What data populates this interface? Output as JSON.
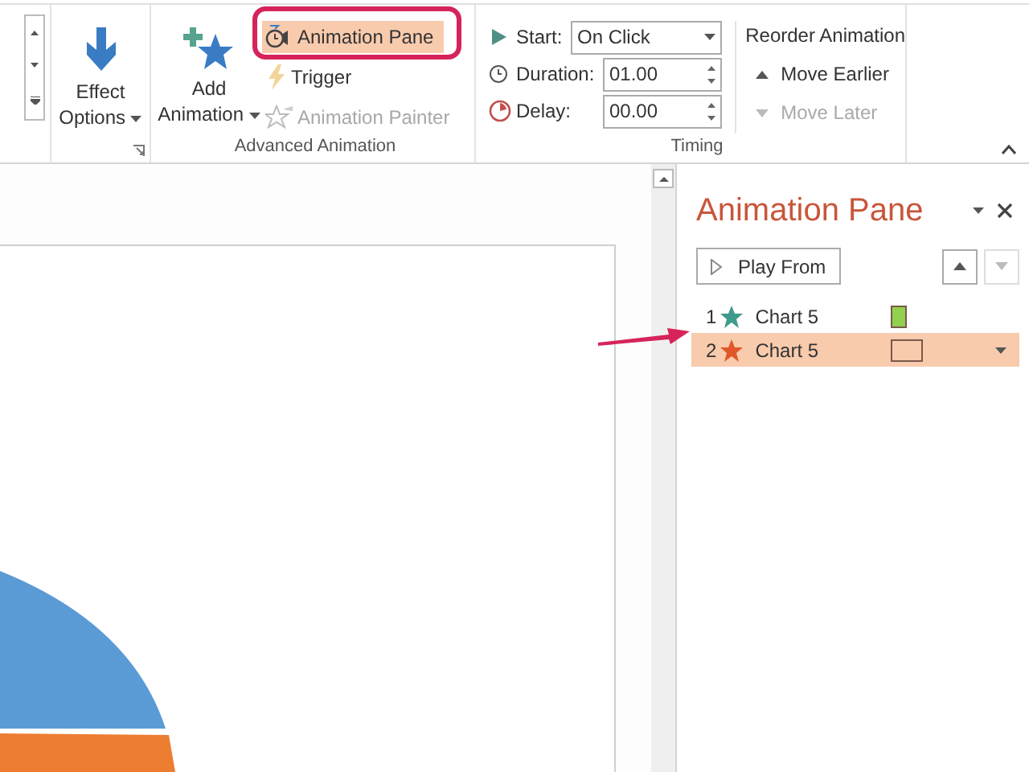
{
  "ribbon": {
    "effect_options": {
      "label": "Effect Options"
    },
    "advanced_animation": {
      "title": "Advanced Animation",
      "add_animation": "Add Animation",
      "buttons": [
        {
          "label": "Animation Pane",
          "selected": true,
          "disabled": false
        },
        {
          "label": "Trigger",
          "selected": false,
          "disabled": false
        },
        {
          "label": "Animation Painter",
          "selected": false,
          "disabled": true
        }
      ]
    },
    "timing": {
      "title": "Timing",
      "fields": [
        {
          "kind": "select",
          "label": "Start:",
          "value": "On Click"
        },
        {
          "kind": "spinner",
          "label": "Duration:",
          "value": "01.00"
        },
        {
          "kind": "spinner",
          "label": "Delay:",
          "value": "00.00"
        }
      ],
      "reorder": {
        "title": "Reorder Animation",
        "buttons": [
          {
            "label": "Move Earlier",
            "disabled": false
          },
          {
            "label": "Move Later",
            "disabled": true
          }
        ]
      }
    }
  },
  "animation_pane": {
    "title": "Animation Pane",
    "play_button": "Play From",
    "move_up_disabled": false,
    "move_down_disabled": true,
    "items": [
      {
        "number": "1",
        "label": "Chart 5",
        "color": "#3f9b8c",
        "kind": "entrance",
        "selected": false
      },
      {
        "number": "2",
        "label": "Chart 5",
        "color": "#e0582a",
        "kind": "emphasis",
        "selected": true
      }
    ]
  }
}
